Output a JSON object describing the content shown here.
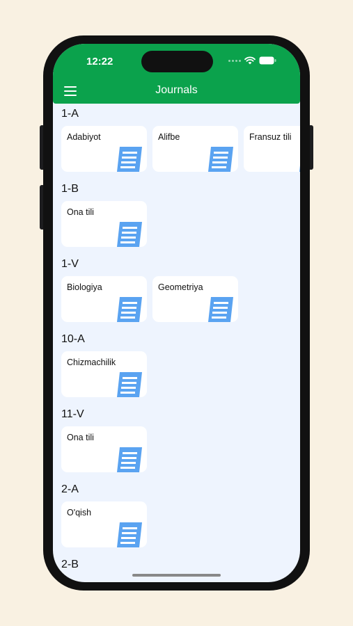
{
  "status_bar": {
    "time": "12:22"
  },
  "header": {
    "title": "Journals"
  },
  "sections": [
    {
      "name": "1-A",
      "cards": [
        "Adabiyot",
        "Alifbe",
        "Fransuz tili"
      ]
    },
    {
      "name": "1-B",
      "cards": [
        "Ona tili"
      ]
    },
    {
      "name": "1-V",
      "cards": [
        "Biologiya",
        "Geometriya"
      ]
    },
    {
      "name": "10-A",
      "cards": [
        "Chizmachilik"
      ]
    },
    {
      "name": "11-V",
      "cards": [
        "Ona tili"
      ]
    },
    {
      "name": "2-A",
      "cards": [
        "O'qish"
      ]
    },
    {
      "name": "2-B",
      "cards": []
    }
  ],
  "icons": {
    "menu": "hamburger-icon",
    "journal": "document-icon",
    "wifi": "wifi-icon",
    "battery": "battery-icon"
  },
  "colors": {
    "header": "#0ba24c",
    "icon": "#5aa3f1",
    "background": "#eef4fe"
  }
}
